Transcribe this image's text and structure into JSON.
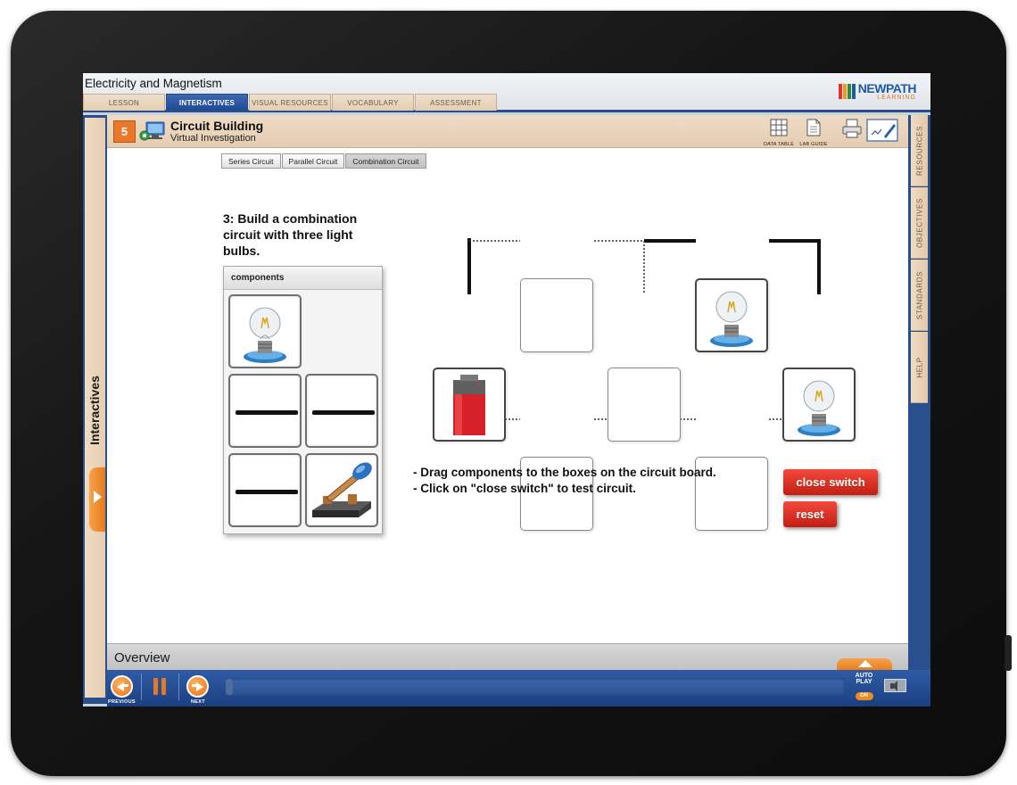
{
  "app": {
    "title": "Electricity and Magnetism",
    "logo_main": "NEWPATH",
    "logo_sub": "LEARNING"
  },
  "nav_tabs": [
    {
      "label": "LESSON",
      "active": false
    },
    {
      "label": "INTERACTIVES",
      "active": true
    },
    {
      "label": "VISUAL RESOURCES",
      "active": false
    },
    {
      "label": "VOCABULARY",
      "active": false
    },
    {
      "label": "ASSESSMENT",
      "active": false
    }
  ],
  "left_rail": {
    "label": "Interactives"
  },
  "right_tabs": [
    {
      "label": "RESOURCES"
    },
    {
      "label": "OBJECTIVES"
    },
    {
      "label": "STANDARDS"
    },
    {
      "label": "HELP"
    }
  ],
  "module": {
    "number": "5",
    "title": "Circuit Building",
    "subtitle": "Virtual Investigation"
  },
  "tools": {
    "data_table": "DATA TABLE",
    "lab_guide": "LAB GUIDE"
  },
  "circuit_tabs": [
    {
      "label": "Series Circuit",
      "active": false
    },
    {
      "label": "Parallel Circuit",
      "active": false
    },
    {
      "label": "Combination Circuit",
      "active": true
    }
  ],
  "instruction": "3: Build a combination circuit with three light bulbs.",
  "components": {
    "header": "components"
  },
  "directions": [
    "- Drag components to the boxes on the circuit board.",
    "- Click on \"close switch\" to test circuit."
  ],
  "buttons": {
    "close_switch": "close switch",
    "reset": "reset"
  },
  "overview": {
    "label": "Overview"
  },
  "controls": {
    "previous": "PREVIOUS",
    "next": "NEXT",
    "autoplay_line1": "AUTO",
    "autoplay_line2": "PLAY",
    "autoplay_state": "ON"
  },
  "colors": {
    "accent_blue": "#2c4d8c",
    "accent_orange": "#e8772a",
    "button_red": "#d8261a",
    "tab_tan": "#e8d4bc"
  },
  "icons": [
    "lightbulb-icon",
    "battery-icon",
    "switch-icon",
    "wire-icon",
    "data-table-icon",
    "lab-guide-icon",
    "print-icon",
    "notepad-icon",
    "speaker-icon"
  ]
}
